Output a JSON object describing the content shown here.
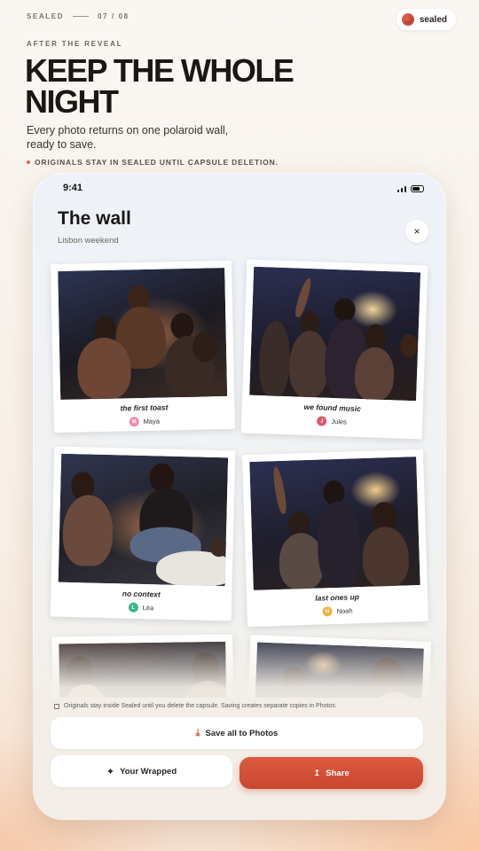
{
  "meta": {
    "brand": "SEALED",
    "step": "07 / 08"
  },
  "brand_pill": {
    "label": "sealed"
  },
  "hero": {
    "eyebrow": "AFTER THE REVEAL",
    "headline": "KEEP THE WHOLE NIGHT",
    "subtitle": "Every photo returns on one polaroid wall, ready to save.",
    "note": "ORIGINALS STAY IN SEALED UNTIL CAPSULE DELETION."
  },
  "phone": {
    "status_time": "9:41",
    "title": "The wall",
    "subtitle": "Lisbon weekend",
    "close_label": "×",
    "polaroids": [
      {
        "caption": "the first toast",
        "author": "Maya",
        "initial": "M",
        "color": "#f08aa9"
      },
      {
        "caption": "we found music",
        "author": "Jules",
        "initial": "J",
        "color": "#e0556b"
      },
      {
        "caption": "no context",
        "author": "Léa",
        "initial": "L",
        "color": "#3fb58b"
      },
      {
        "caption": "last ones up",
        "author": "Noah",
        "initial": "N",
        "color": "#f0b43c"
      }
    ],
    "info_text": "Originals stay inside Sealed until you delete the capsule. Saving creates separate copies in Photos.",
    "buttons": {
      "save_all": "Save all to Photos",
      "wrapped": "Your Wrapped",
      "share": "Share"
    }
  }
}
